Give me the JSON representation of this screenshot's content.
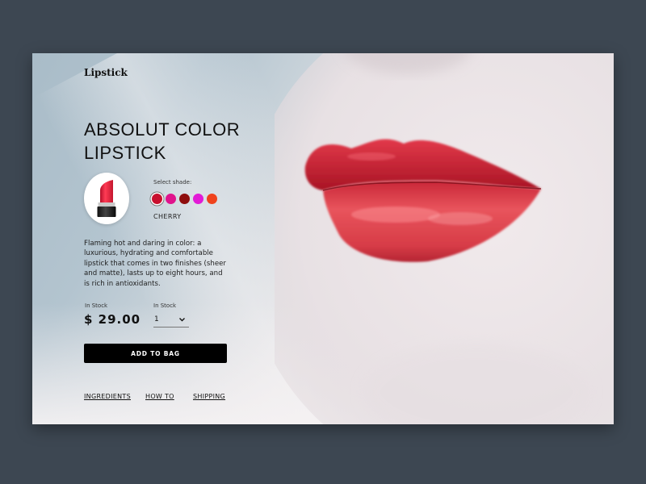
{
  "brand": "Lipstick",
  "product": {
    "title_line1": "ABSOLUT COLOR",
    "title_line2": "LIPSTICK",
    "image_icon": "lipstick-icon",
    "description": "Flaming hot and daring in color: a luxurious, hydrating and comfortable lipstick that comes in two finishes (sheer and matte), lasts up to eight hours, and is rich in antioxidants."
  },
  "shade": {
    "label": "Select shade:",
    "selected": "CHERRY",
    "swatches": [
      "#c8102e",
      "#e0138c",
      "#8e0d0d",
      "#e21bd6",
      "#f0431d"
    ]
  },
  "price": {
    "stock_label": "In Stock",
    "value": "$ 29.00"
  },
  "quantity": {
    "stock_label": "In Stock",
    "value": "1",
    "icon": "chevron-down-icon"
  },
  "actions": {
    "add_to_bag": "ADD TO BAG"
  },
  "links": [
    "INGREDIENTS",
    "HOW TO",
    "SHIPPING"
  ],
  "colors": {
    "background": "#3d4752",
    "button": "#000000",
    "lip_red": "#d8333f"
  }
}
